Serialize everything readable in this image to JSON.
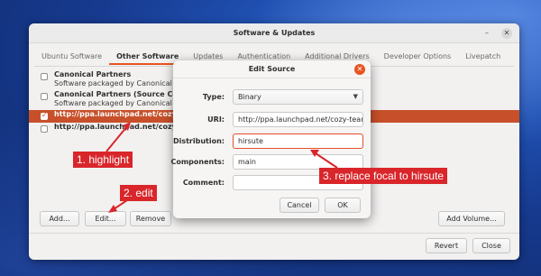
{
  "window": {
    "title": "Software & Updates",
    "minimize_glyph": "–",
    "close_glyph": "✕"
  },
  "tabs": [
    {
      "label": "Ubuntu Software"
    },
    {
      "label": "Other Software"
    },
    {
      "label": "Updates"
    },
    {
      "label": "Authentication"
    },
    {
      "label": "Additional Drivers"
    },
    {
      "label": "Developer Options"
    },
    {
      "label": "Livepatch"
    }
  ],
  "active_tab": "Other Software",
  "sources": [
    {
      "name": "Canonical Partners",
      "sub": "Software packaged by Canonical for",
      "checked": false
    },
    {
      "name": "Canonical Partners (Source Code)",
      "sub": "Software packaged by Canonical for",
      "checked": false
    },
    {
      "name": "http://ppa.launchpad.net/cozy-tea",
      "checked": true,
      "selected": true
    },
    {
      "name": "http://ppa.launchpad.net/cozy-tea",
      "checked": false
    }
  ],
  "buttons": {
    "add": "Add...",
    "edit": "Edit...",
    "remove": "Remove",
    "add_volume": "Add Volume...",
    "revert": "Revert",
    "close": "Close"
  },
  "dialog": {
    "title": "Edit Source",
    "close_glyph": "✕",
    "type_label": "Type:",
    "type_value": "Binary",
    "uri_label": "URI:",
    "uri_value": "http://ppa.launchpad.net/cozy-team/",
    "distribution_label": "Distribution:",
    "distribution_value": "hirsute",
    "components_label": "Components:",
    "components_value": "main",
    "comment_label": "Comment:",
    "comment_value": "",
    "cancel": "Cancel",
    "ok": "OK"
  },
  "annotations": {
    "step1": "1. highlight",
    "step2": "2. edit",
    "step3": "3. replace focal to hirsute"
  },
  "colors": {
    "accent": "#e95420",
    "selection": "#c7502a",
    "annotation": "#d9262b"
  }
}
